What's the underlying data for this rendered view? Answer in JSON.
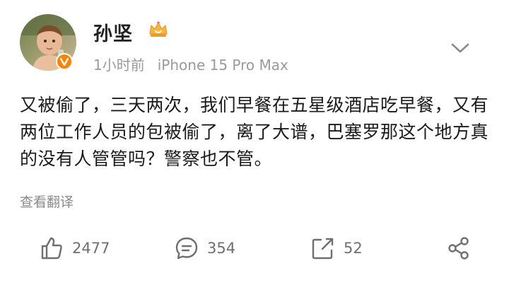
{
  "user": {
    "name": "孙坚",
    "avatar_icon": "child-photo-avatar",
    "verified_icon": "verified-v-badge",
    "member_icon": "crown-icon"
  },
  "meta": {
    "time": "1小时前",
    "device": "iPhone 15 Pro Max"
  },
  "post": {
    "text": "又被偷了，三天两次，我们早餐在五星级酒店吃早餐，又有两位工作人员的包被偷了，离了大谱，巴塞罗那这个地方真的没有人管管吗？警察也不管。",
    "translate_label": "查看翻译"
  },
  "actions": {
    "likes": "2477",
    "comments": "354",
    "reposts": "52"
  },
  "colors": {
    "text": "#1a1a1a",
    "muted": "#9a9a9a",
    "verified": "#ff8200",
    "crown": "#f6b73c"
  }
}
